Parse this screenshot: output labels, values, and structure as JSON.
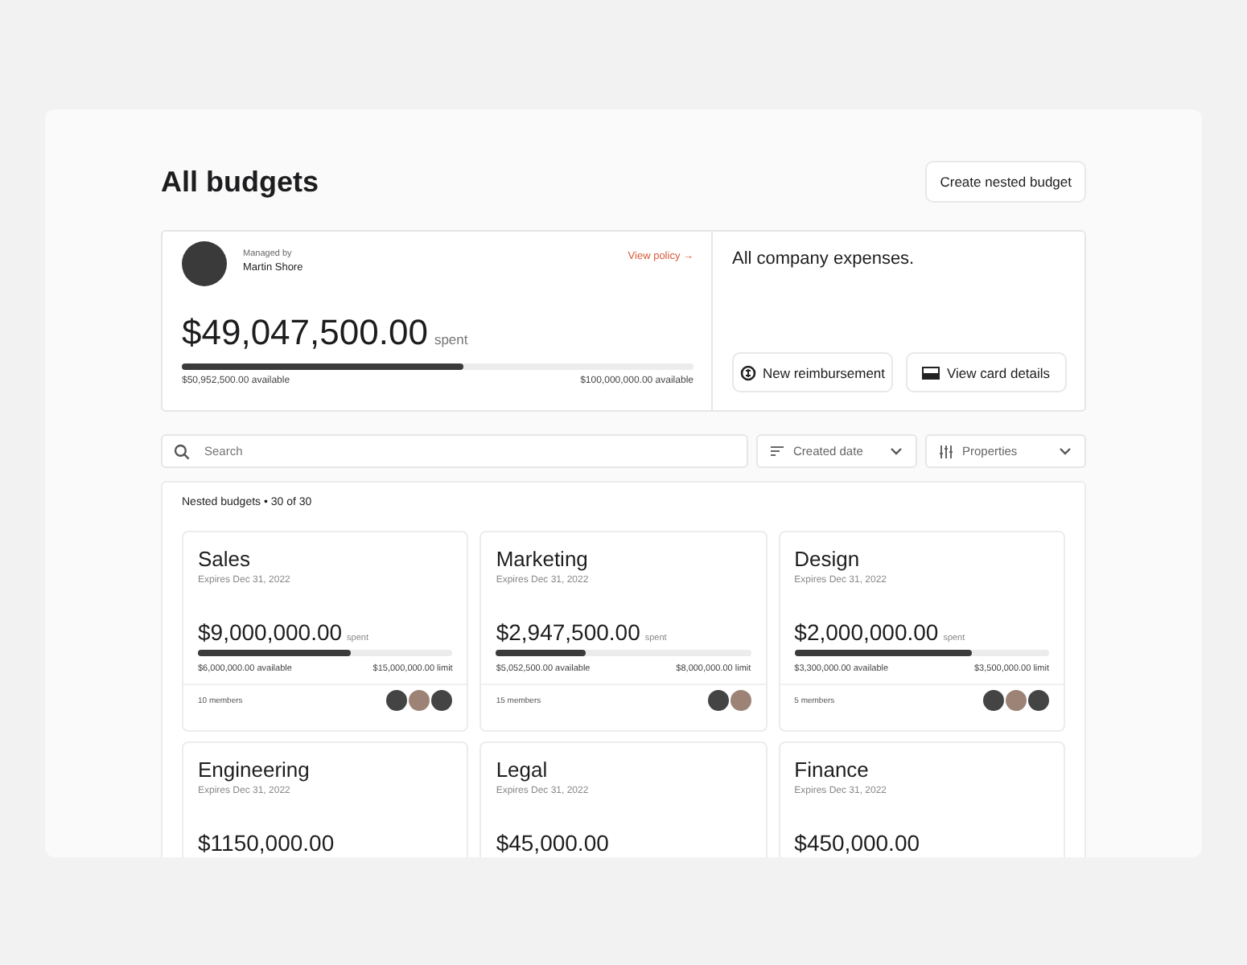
{
  "header": {
    "title": "All budgets",
    "action": "Create nested budget"
  },
  "summary": {
    "managed_label": "Managed by",
    "manager": "Martin Shore",
    "policy_link": "View policy →",
    "amount": "$49,047,500.00",
    "amount_suffix": "spent",
    "level": 0.55,
    "available": "$50,952,500.00 available",
    "limit": "$100,000,000.00 available",
    "description": "All company expenses.",
    "buttons": [
      {
        "label": "New reimbursement",
        "kind": "reimburse"
      },
      {
        "label": "View card details",
        "kind": "card"
      }
    ]
  },
  "filters": {
    "search": {
      "placeholder": "Search"
    },
    "dropdowns": [
      {
        "label": "Created date",
        "kind": "sort"
      },
      {
        "label": "Properties",
        "kind": "properties"
      }
    ]
  },
  "nested": {
    "heading": "Nested budgets • 30 of 30",
    "budgets": [
      {
        "name": "Sales",
        "expires": "Expires Dec 31, 2022",
        "amount": "$9,000,000.00",
        "amount_suffix": "spent",
        "level": 0.6,
        "available": "$6,000,000.00 available",
        "limit": "$15,000,000.00 limit",
        "members": "10 members",
        "avatars": [
          {
            "kind": "photo"
          },
          {
            "kind": "photo"
          },
          {
            "kind": "photo"
          }
        ]
      },
      {
        "name": "Marketing",
        "expires": "Expires Dec 31, 2022",
        "amount": "$2,947,500.00",
        "amount_suffix": "spent",
        "level": 0.35,
        "available": "$5,052,500.00 available",
        "limit": "$8,000,000.00 limit",
        "members": "15 members",
        "avatars": [
          {
            "kind": "photo"
          },
          {
            "kind": "photo"
          }
        ]
      },
      {
        "name": "Design",
        "expires": "Expires Dec 31, 2022",
        "amount": "$2,000,000.00",
        "amount_suffix": "spent",
        "level": 0.7,
        "available": "$3,300,000.00 available",
        "limit": "$3,500,000.00 limit",
        "members": "5 members",
        "avatars": [
          {
            "kind": "photo"
          },
          {
            "kind": "photo"
          },
          {
            "kind": "photo"
          }
        ]
      },
      {
        "name": "Engineering",
        "expires": "Expires Dec 31, 2022",
        "amount": "$1150,000.00"
      },
      {
        "name": "Legal",
        "expires": "Expires Dec 31, 2022",
        "amount": "$45,000.00"
      },
      {
        "name": "Finance",
        "expires": "Expires Dec 31, 2022",
        "amount": "$450,000.00"
      }
    ]
  }
}
